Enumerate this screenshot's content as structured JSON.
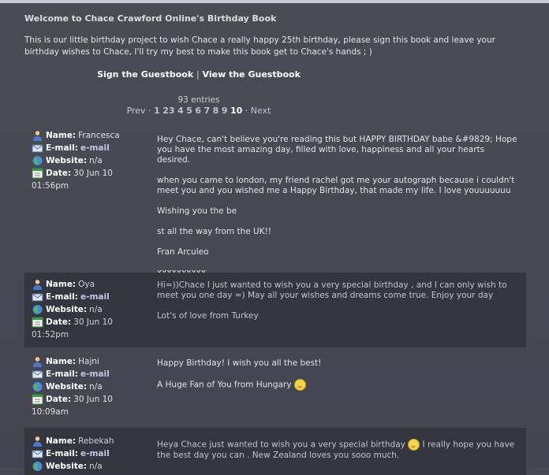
{
  "header": {
    "title": "Welcome to Chace Crawford Online's Birthday Book",
    "intro": "This is our little birthday project to wish Chace a really happy 25th birthday, please sign this book and leave your birthday wishes to Chace, I'll try my best to make this book get to Chace's hands ; )"
  },
  "links": {
    "sign": "Sign the Guestbook",
    "separator": "|",
    "view": "View the Guestbook"
  },
  "pagination": {
    "entries": "93 entries",
    "prev": "Prev ·",
    "pages": [
      "1",
      "2",
      "3",
      "4",
      "5",
      "6",
      "7",
      "8",
      "9"
    ],
    "current": "10",
    "dot": "·",
    "next": "Next"
  },
  "labels": {
    "name": "Name:",
    "email": "E-mail:",
    "website": "Website:",
    "date": "Date:"
  },
  "entries": [
    {
      "name": "Francesca",
      "email": "e-mail",
      "website": "n/a",
      "date": "30 Jun 10",
      "time": "01:56pm",
      "paragraphs": [
        "Hey Chace, can't believe you're reading this but HAPPY BIRTHDAY babe &#9829; Hope you have the most amazing day, filled with love, happiness and all your hearts desired.",
        "when you came to london, my friend rachel got me your autograph because i couldn't meet you and you wished me a Happy Birthday, that made my life. I love youuuuuuu",
        "Wishing you the be",
        "st all the way from the UK!!",
        "Fran Arculeo",
        "xxxxxxxxxx"
      ]
    },
    {
      "name": "Oya",
      "email": "e-mail",
      "website": "n/a",
      "date": "30 Jun 10",
      "time": "01:52pm",
      "paragraphs": [
        "Hi=))Chace I just wanted to wish you a very special birthday , and I can only wish to meet you one day =) May all your wishes and dreams come true. Enjoy your day",
        "Lot's of love from Turkey"
      ]
    },
    {
      "name": "Hajni",
      "email": "e-mail",
      "website": "n/a",
      "date": "30 Jun 10",
      "time": "10:09am",
      "paragraphs": [
        "Happy Birthday! I wish you all the best!",
        "A Huge Fan of You from Hungary"
      ]
    },
    {
      "name": "Rebekah",
      "email": "e-mail",
      "website": "n/a",
      "date": "",
      "time": "",
      "p1a": "Heya Chace just wanted to wish you a very special birthday",
      "p1b": " I really hope you have the best day you can . New Zealand loves you sooo much."
    }
  ],
  "icons": [
    "user-icon",
    "email-icon",
    "globe-icon",
    "calendar-icon",
    "smiley-icon"
  ]
}
